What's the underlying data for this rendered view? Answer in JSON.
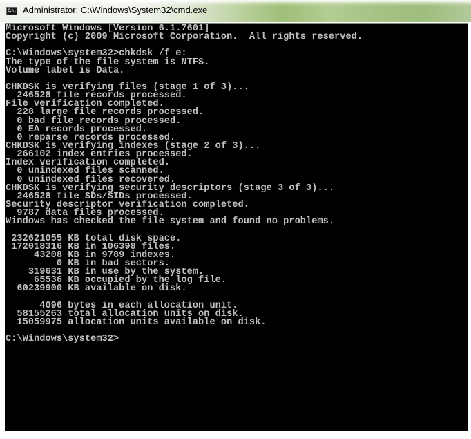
{
  "window": {
    "title": "Administrator: C:\\Windows\\System32\\cmd.exe",
    "icon": "cmd-icon",
    "icon_glyph": "C:\\."
  },
  "console": {
    "lines": [
      "Microsoft Windows [Version 6.1.7601]",
      "Copyright (c) 2009 Microsoft Corporation.  All rights reserved.",
      "",
      "C:\\Windows\\system32>chkdsk /f e:",
      "The type of the file system is NTFS.",
      "Volume label is Data.",
      "",
      "CHKDSK is verifying files (stage 1 of 3)...",
      "  246528 file records processed.",
      "File verification completed.",
      "  228 large file records processed.",
      "  0 bad file records processed.",
      "  0 EA records processed.",
      "  0 reparse records processed.",
      "CHKDSK is verifying indexes (stage 2 of 3)...",
      "  266102 index entries processed.",
      "Index verification completed.",
      "  0 unindexed files scanned.",
      "  0 unindexed files recovered.",
      "CHKDSK is verifying security descriptors (stage 3 of 3)...",
      "  246528 file SDs/SIDs processed.",
      "Security descriptor verification completed.",
      "  9787 data files processed.",
      "Windows has checked the file system and found no problems.",
      "",
      " 232621055 KB total disk space.",
      " 172018316 KB in 106398 files.",
      "     43208 KB in 9789 indexes.",
      "         0 KB in bad sectors.",
      "    319631 KB in use by the system.",
      "     65536 KB occupied by the log file.",
      "  60239900 KB available on disk.",
      "",
      "      4096 bytes in each allocation unit.",
      "  58155263 total allocation units on disk.",
      "  15059975 allocation units available on disk.",
      "",
      "C:\\Windows\\system32>"
    ],
    "prompt": "C:\\Windows\\system32>",
    "colors": {
      "background": "#000000",
      "foreground": "#c0c0c0"
    }
  }
}
